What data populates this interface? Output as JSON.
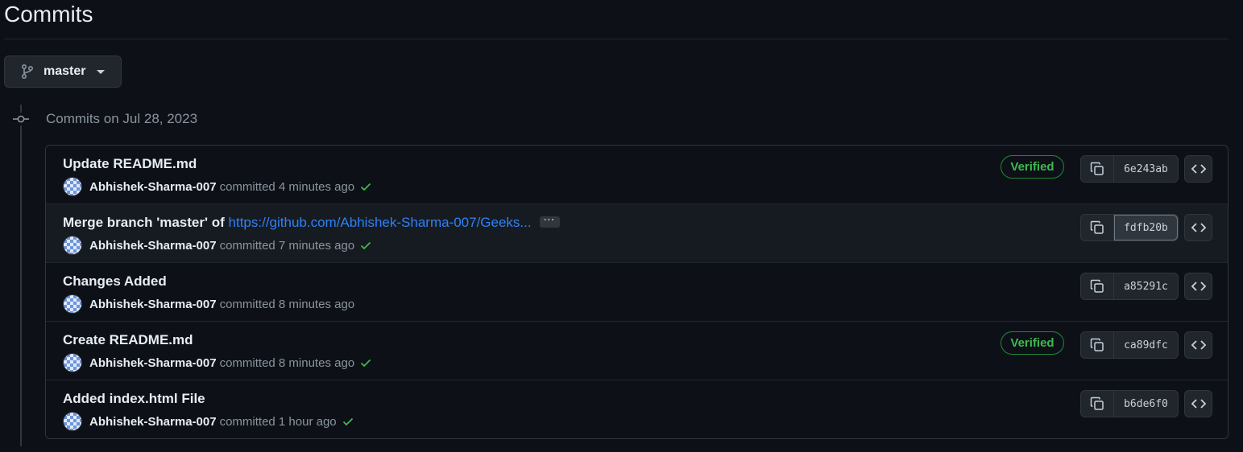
{
  "page": {
    "title": "Commits"
  },
  "branch": {
    "name": "master"
  },
  "timeline": {
    "date_label": "Commits on Jul 28, 2023"
  },
  "commits": [
    {
      "title": "Update README.md",
      "link": "",
      "author": "Abhishek-Sharma-007",
      "time": "committed 4 minutes ago",
      "verified": "Verified",
      "status_check": true,
      "sha": "6e243ab"
    },
    {
      "title": "Merge branch 'master' of ",
      "link": "https://github.com/Abhishek-Sharma-007/Geeks...",
      "author": "Abhishek-Sharma-007",
      "time": "committed 7 minutes ago",
      "verified": "",
      "status_check": true,
      "sha": "fdfb20b"
    },
    {
      "title": "Changes Added",
      "link": "",
      "author": "Abhishek-Sharma-007",
      "time": "committed 8 minutes ago",
      "verified": "",
      "status_check": false,
      "sha": "a85291c"
    },
    {
      "title": "Create README.md",
      "link": "",
      "author": "Abhishek-Sharma-007",
      "time": "committed 8 minutes ago",
      "verified": "Verified",
      "status_check": true,
      "sha": "ca89dfc"
    },
    {
      "title": "Added index.html File",
      "link": "",
      "author": "Abhishek-Sharma-007",
      "time": "committed 1 hour ago",
      "verified": "",
      "status_check": true,
      "sha": "b6de6f0"
    }
  ],
  "colors": {
    "background": "#0d1117",
    "border": "#30363d",
    "verified_green": "#3fb950",
    "link_blue": "#2f81f7"
  }
}
